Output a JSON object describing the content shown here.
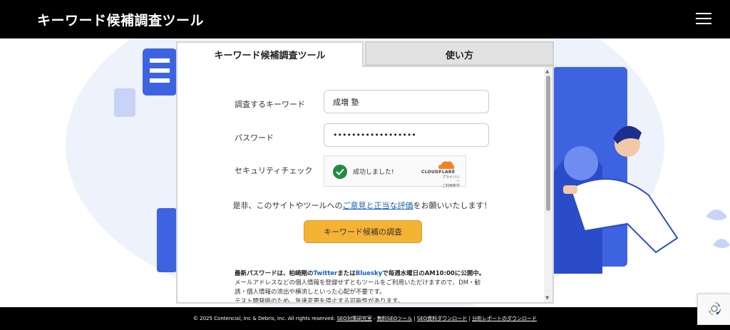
{
  "header": {
    "title": "キーワード候補調査ツール",
    "menu_icon": "hamburger-menu-icon"
  },
  "tabs": {
    "active": "キーワード候補調査ツール",
    "inactive": "使い方"
  },
  "form": {
    "keyword_label": "調査するキーワード",
    "keyword_value": "成増 塾",
    "password_label": "パスワード",
    "password_value": "••••••••••••••••••",
    "security_label": "セキュリティチェック",
    "captcha": {
      "status": "成功しました!",
      "brand": "CLOUDFLARE",
      "links_line1": "プライバシー",
      "links_line2": "ご利用条件"
    },
    "request_prefix": "是非、このサイトやツールへの",
    "request_link": "ご意見と正当な評価",
    "request_suffix": "をお願いいたします！",
    "submit_label": "キーワード候補の調査"
  },
  "notice": {
    "line1_a": "最新パスワードは、柏崎剛の",
    "twitter": "Twitter",
    "line1_b": "または",
    "bluesky": "Bluesky",
    "line1_c": "で毎週水曜日のAM10:00に公開中。",
    "line2": "メールアドレスなどの個人情報を登録せずともツールをご利用いただけますので、DM・勧誘・個人情報の流出や横流しといった心配が不要です。",
    "line3": "テスト開発版のため、急速変更を停止する可能性があります。"
  },
  "footer": {
    "copyright": "© 2025 Contencial, Inc & Debris, Inc. All rights reserved.",
    "link1": "SEO対策研究室",
    "sep1": " - ",
    "link2": "無料SEOツール",
    "sep2": " | ",
    "link3": "SEO資料ダウンロード",
    "sep3": " | ",
    "link4": "分析レポートのダウンロード"
  },
  "colors": {
    "accent_button": "#f5b335",
    "link": "#1a5fb4",
    "illustration_blue": "#3d63e0"
  }
}
